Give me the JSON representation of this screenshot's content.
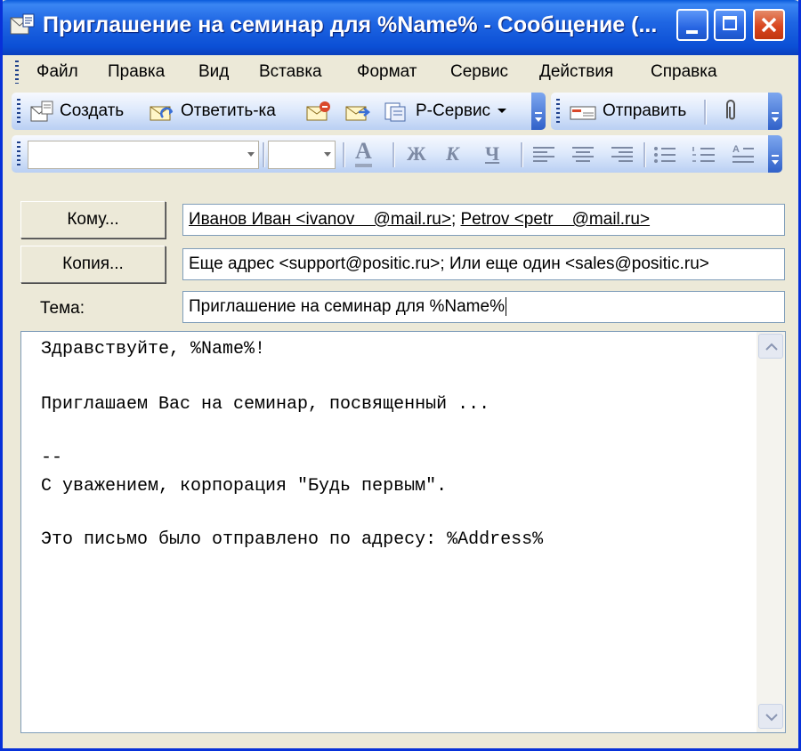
{
  "window": {
    "title": "Приглашение на семинар для %Name% - Сообщение (..."
  },
  "menu": [
    "Файл",
    "Правка",
    "Вид",
    "Вставка",
    "Формат",
    "Сервис",
    "Действия",
    "Справка"
  ],
  "toolbar": {
    "create_label": "Создать",
    "reply_label": "Ответить-ка",
    "rservice_label": "Р-Сервис",
    "send_label": "Отправить"
  },
  "format_toolbar": {
    "font_value": "",
    "size_value": "",
    "font_color_glyph": "A",
    "bold_glyph": "Ж",
    "italic_glyph": "К",
    "underline_glyph": "Ч"
  },
  "fields": {
    "to_button": "Кому...",
    "to_names": [
      "Иванов Иван <ivanov    @mail.ru>",
      "Petrov <petr    @mail.ru>"
    ],
    "cc_button": "Копия...",
    "cc_value": "Еще адрес <support@positic.ru>; Или еще один <sales@positic.ru>",
    "subject_label": "Тема:",
    "subject_value": "Приглашение на семинар для %Name%"
  },
  "body": {
    "lines": [
      "Здравствуйте, %Name%!",
      "Приглашаем Вас на семинар, посвященный ...",
      "--",
      "С уважением, корпорация \"Будь первым\".",
      "Это письмо было отправлено по адресу: %Address%"
    ]
  },
  "colors": {
    "titlebar": "#0a5bdc",
    "window_face": "#ece9d8",
    "field_border": "#7f9db9"
  }
}
